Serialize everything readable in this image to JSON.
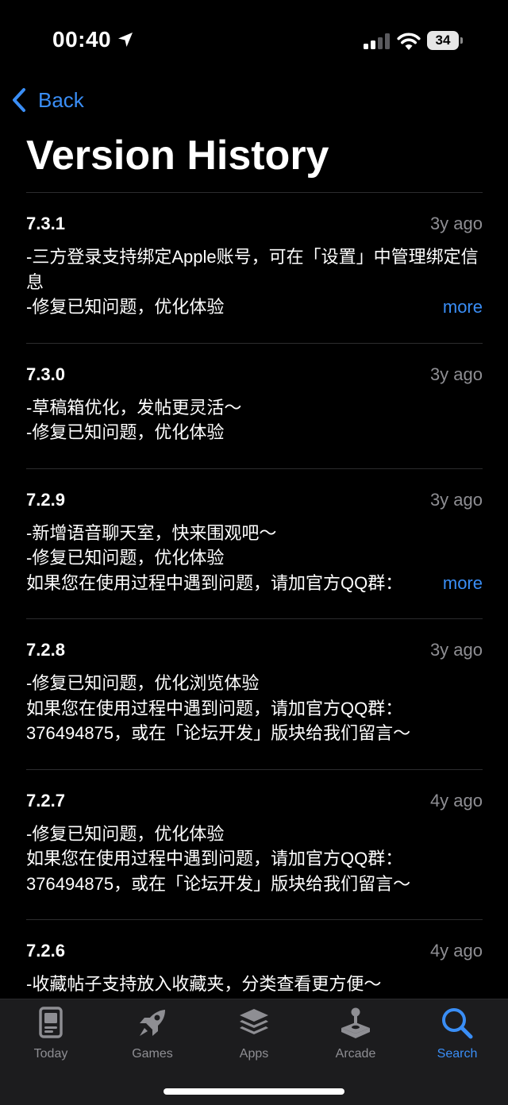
{
  "status_bar": {
    "time": "00:40",
    "battery": "34"
  },
  "nav": {
    "back_label": "Back",
    "title": "Version History"
  },
  "entries": [
    {
      "version": "7.3.1",
      "ago": "3y ago",
      "lines": [
        "-三方登录支持绑定Apple账号，可在「设置」中管理绑定信息",
        "-修复已知问题，优化体验"
      ],
      "more": "more"
    },
    {
      "version": "7.3.0",
      "ago": "3y ago",
      "lines": [
        "-草稿箱优化，发帖更灵活～",
        "-修复已知问题，优化体验"
      ]
    },
    {
      "version": "7.2.9",
      "ago": "3y ago",
      "lines": [
        "-新增语音聊天室，快来围观吧～",
        "-修复已知问题，优化体验",
        "如果您在使用过程中遇到问题，请加官方QQ群："
      ],
      "more": "more"
    },
    {
      "version": "7.2.8",
      "ago": "3y ago",
      "lines": [
        "-修复已知问题，优化浏览体验",
        "如果您在使用过程中遇到问题，请加官方QQ群：",
        "376494875，或在「论坛开发」版块给我们留言～"
      ]
    },
    {
      "version": "7.2.7",
      "ago": "4y ago",
      "lines": [
        "-修复已知问题，优化体验",
        "如果您在使用过程中遇到问题，请加官方QQ群：",
        "376494875，或在「论坛开发」版块给我们留言～"
      ]
    },
    {
      "version": "7.2.6",
      "ago": "4y ago",
      "lines": [
        "-收藏帖子支持放入收藏夹，分类查看更方便～"
      ]
    }
  ],
  "tabs": [
    {
      "label": "Today",
      "icon": "today-icon",
      "active": false
    },
    {
      "label": "Games",
      "icon": "rocket-icon",
      "active": false
    },
    {
      "label": "Apps",
      "icon": "apps-stack-icon",
      "active": false
    },
    {
      "label": "Arcade",
      "icon": "joystick-icon",
      "active": false
    },
    {
      "label": "Search",
      "icon": "search-icon",
      "active": true
    }
  ],
  "colors": {
    "accent": "#3a8ef6",
    "secondary_text": "#8e8e93",
    "background": "#000000",
    "tabbar": "#1c1c1e"
  }
}
